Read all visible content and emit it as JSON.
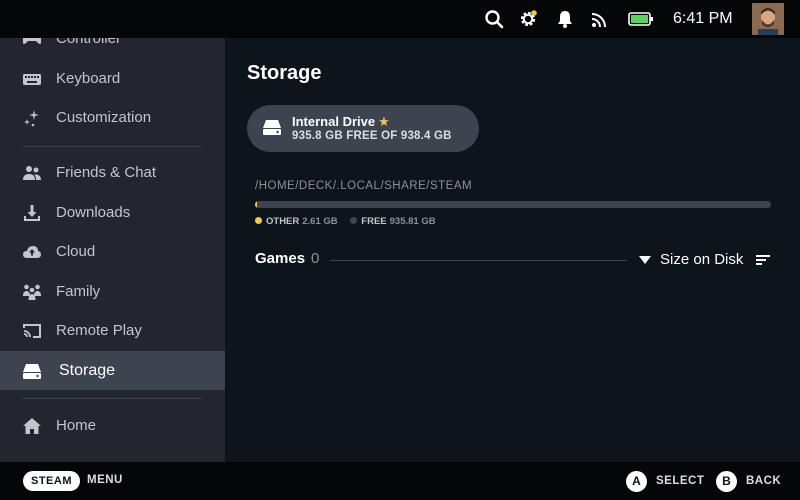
{
  "status_bar": {
    "time": "6:41 PM",
    "icons": [
      "search-icon",
      "settings-gear-icon",
      "notifications-bell-icon",
      "cast-icon",
      "battery-icon"
    ]
  },
  "sidebar": {
    "items": [
      {
        "label": "Controller",
        "icon": "controller-icon"
      },
      {
        "label": "Keyboard",
        "icon": "keyboard-icon"
      },
      {
        "label": "Customization",
        "icon": "sparkle-icon"
      },
      {
        "label": "Friends & Chat",
        "icon": "friends-icon"
      },
      {
        "label": "Downloads",
        "icon": "download-icon"
      },
      {
        "label": "Cloud",
        "icon": "cloud-icon"
      },
      {
        "label": "Family",
        "icon": "family-icon"
      },
      {
        "label": "Remote Play",
        "icon": "remote-play-icon"
      },
      {
        "label": "Storage",
        "icon": "storage-icon",
        "active": true
      },
      {
        "label": "Home",
        "icon": "home-icon"
      }
    ]
  },
  "main": {
    "title": "Storage",
    "drive": {
      "name": "Internal Drive",
      "star": "★",
      "free_text": "935.8 GB FREE OF 938.4 GB"
    },
    "path": "/HOME/DECK/.LOCAL/SHARE/STEAM",
    "usage_fraction": 0.0028,
    "legend": [
      {
        "label": "OTHER",
        "value": "2.61 GB",
        "color": "#f2c94c"
      },
      {
        "label": "FREE",
        "value": "935.81 GB",
        "color": "#3d4450"
      }
    ],
    "games": {
      "label": "Games",
      "count": "0",
      "sort_label": "Size on Disk"
    }
  },
  "bottom_bar": {
    "steam_label": "STEAM",
    "menu_label": "MENU",
    "a_button": "A",
    "select_label": "SELECT",
    "b_button": "B",
    "back_label": "BACK"
  },
  "colors": {
    "accent_yellow": "#f2c94c",
    "sidebar_bg": "#23262e",
    "active_item_bg": "#3d4450",
    "main_bg": "#0e141b",
    "bar_bg": "#050608"
  }
}
